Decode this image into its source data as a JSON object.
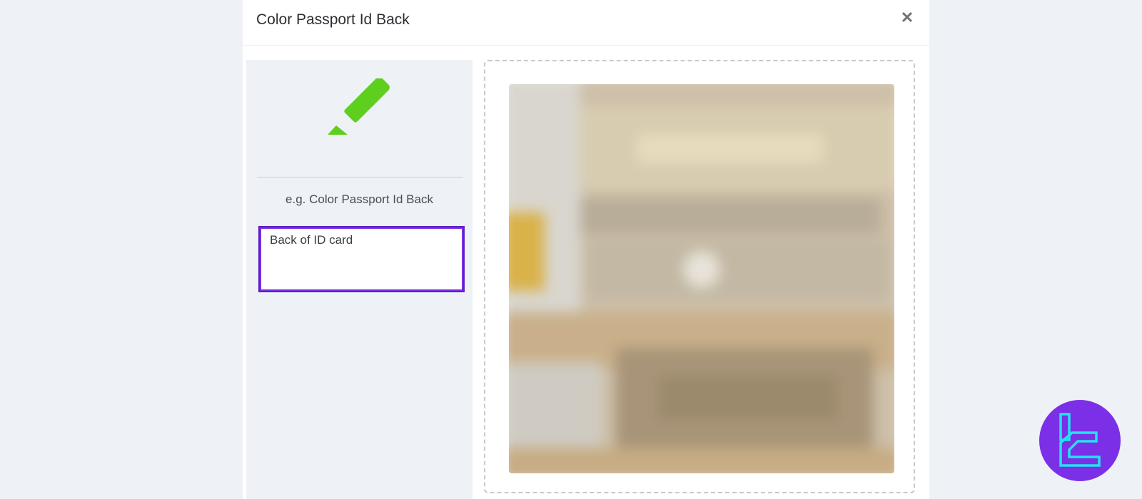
{
  "modal": {
    "title": "Color Passport Id Back",
    "close_glyph": "✕"
  },
  "left_panel": {
    "icon": "highlighter-marker-icon",
    "icon_color": "#5fcf1e",
    "example_text": "e.g. Color Passport Id Back",
    "description_value": "Back of ID card"
  },
  "dropzone": {
    "preview": "blurred-id-card-back-image"
  },
  "colors": {
    "accent": "#7b2fe6",
    "badge_stroke": "#22e3f2"
  }
}
